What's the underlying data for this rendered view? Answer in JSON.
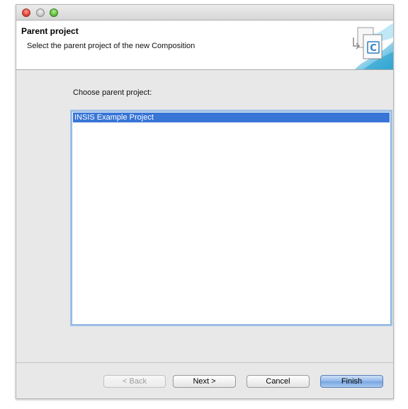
{
  "header": {
    "title": "Parent project",
    "description": "Select the parent project of the new Composition",
    "graphic_icon": "new-composition-wizard-icon",
    "graphic_letter": "C"
  },
  "content": {
    "label": "Choose parent project:",
    "projects": [
      "INSIS Example Project"
    ],
    "selected_index": 0
  },
  "buttons": {
    "back": "< Back",
    "next": "Next >",
    "cancel": "Cancel",
    "finish": "Finish"
  },
  "colors": {
    "selection": "#3875d7",
    "focus_ring": "#9ec3ec",
    "default_button": "#8fb6e8"
  }
}
